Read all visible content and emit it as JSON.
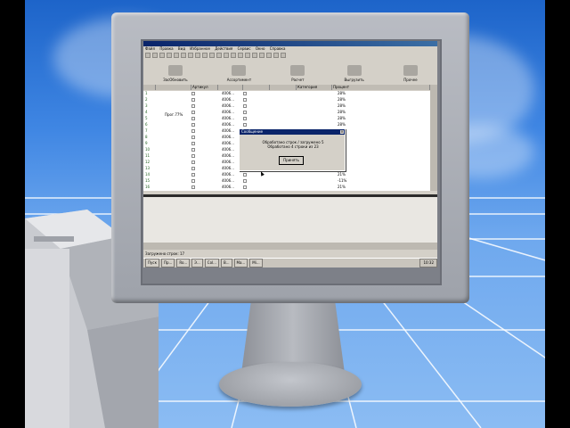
{
  "screen": {
    "window_title": "",
    "menu": [
      "Файл",
      "Правка",
      "Вид",
      "Избранное",
      "Действия",
      "Сервис",
      "Окно",
      "Справка"
    ],
    "big_buttons": [
      "ЗасОбновить",
      "Ассортимент",
      "Расчет",
      "Выгрузить",
      "Прочее"
    ],
    "columns": [
      "",
      "",
      "Артикул",
      "",
      "",
      "",
      "Категория",
      "Процент"
    ],
    "rows": [
      {
        "idx": "1",
        "code": "4006...",
        "pct": "28%"
      },
      {
        "idx": "2",
        "code": "4006...",
        "pct": "28%"
      },
      {
        "idx": "3",
        "code": "4006...",
        "pct": "28%"
      },
      {
        "idx": "4",
        "code": "4006...",
        "pct": "28%"
      },
      {
        "idx": "5",
        "code": "4006...",
        "pct": "28%"
      },
      {
        "idx": "6",
        "code": "4006...",
        "pct": "28%"
      },
      {
        "idx": "7",
        "code": "4006...",
        "pct": "%"
      },
      {
        "idx": "8",
        "code": "4006...",
        "pct": "%"
      },
      {
        "idx": "9",
        "code": "4006...",
        "pct": "%"
      },
      {
        "idx": "10",
        "code": "4006...",
        "pct": "%"
      },
      {
        "idx": "11",
        "code": "4006...",
        "pct": "%"
      },
      {
        "idx": "12",
        "code": "4006...",
        "pct": "%"
      },
      {
        "idx": "13",
        "code": "4006...",
        "pct": "%"
      },
      {
        "idx": "14",
        "code": "4006...",
        "pct": "21%"
      },
      {
        "idx": "15",
        "code": "4006...",
        "pct": "-11%"
      },
      {
        "idx": "16",
        "code": "4006...",
        "pct": "21%"
      }
    ],
    "side_label": "Прог.77%",
    "status": "Загружено строк: 17",
    "taskbar": {
      "start": "Пуск",
      "items": [
        "Пр...",
        "Ro...",
        "Э...",
        "Col...",
        "B...",
        "Ma...",
        "Mi..."
      ],
      "tray": "10:32"
    },
    "dialog": {
      "title": "Сообщение",
      "message_line1": "Обработано строк / загружено 5",
      "message_line2": "Обработано 4 строки из 23",
      "ok_label": "Принять"
    }
  },
  "colors": {
    "sky_top": "#1d64c9",
    "sky_bottom": "#8bbcf3",
    "titlebar": "#0a246a",
    "window_face": "#d4d0c8",
    "monitor": "#b9bcc3"
  }
}
